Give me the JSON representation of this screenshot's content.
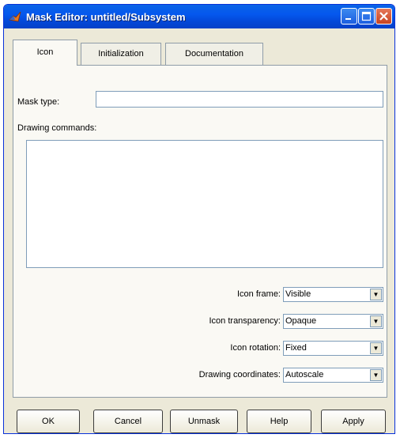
{
  "window": {
    "title": "Mask Editor: untitled/Subsystem"
  },
  "tabs": [
    {
      "label": "Icon",
      "active": true
    },
    {
      "label": "Initialization",
      "active": false
    },
    {
      "label": "Documentation",
      "active": false
    }
  ],
  "icon_tab": {
    "mask_type_label": "Mask type:",
    "mask_type_value": "",
    "drawing_commands_label": "Drawing commands:",
    "drawing_commands_value": "",
    "icon_frame_label": "Icon frame:",
    "icon_frame_value": "Visible",
    "icon_transparency_label": "Icon transparency:",
    "icon_transparency_value": "Opaque",
    "icon_rotation_label": "Icon rotation:",
    "icon_rotation_value": "Fixed",
    "drawing_coordinates_label": "Drawing coordinates:",
    "drawing_coordinates_value": "Autoscale"
  },
  "buttons": {
    "ok": "OK",
    "cancel": "Cancel",
    "unmask": "Unmask",
    "help": "Help",
    "apply": "Apply"
  },
  "colors": {
    "titlebar": "#0558ee",
    "dialog_bg": "#ece9d8",
    "close_button": "#c84420"
  }
}
